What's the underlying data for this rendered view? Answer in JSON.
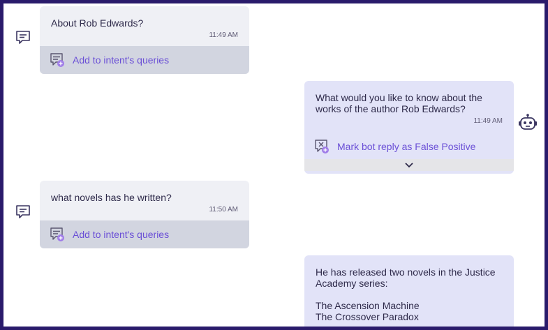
{
  "messages": [
    {
      "text": "About Rob Edwards?",
      "time": "11:49 AM",
      "action": "Add to intent's queries"
    },
    {
      "text": "What would you like to know about the works of the author Rob Edwards?",
      "time": "11:49 AM",
      "action": "Mark bot reply as False Positive"
    },
    {
      "text": "what novels has he written?",
      "time": "11:50 AM",
      "action": "Add to intent's queries"
    },
    {
      "text": "He has released two novels in the Justice Academy series:\n\nThe Ascension Machine\nThe Crossover Paradox"
    }
  ],
  "icons": {
    "user": "chat-message-icon",
    "bot": "robot-icon",
    "add_query": "add-query-icon",
    "false_positive": "mark-false-positive-icon",
    "expand": "chevron-down-icon"
  },
  "colors": {
    "frame_border": "#2a1b6b",
    "user_bubble": "#eff0f5",
    "bot_bubble": "#e2e3f8",
    "action_text": "#6a4fd6"
  }
}
